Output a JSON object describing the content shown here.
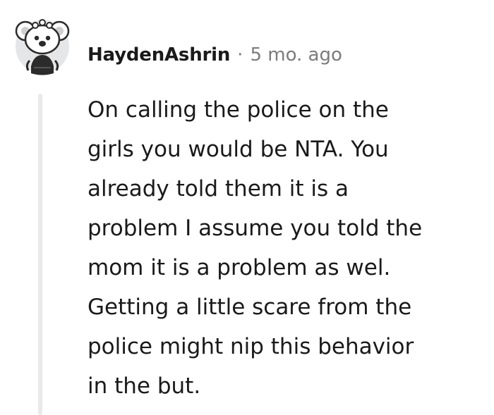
{
  "comment": {
    "author": "HaydenAshrin",
    "separator": "·",
    "time_ago": "5 mo. ago",
    "avatar_icon": "snoo-koala-avatar-icon",
    "body_lines": [
      "On calling the police on the",
      "girls you would be NTA. You",
      "already told them it is a",
      "problem I assume you told the",
      "mom it is a problem as wel.",
      "Getting a little scare from the",
      "police might nip this behavior",
      "in the but."
    ]
  },
  "colors": {
    "text": "#1a1a1b",
    "meta": "#7c7c7c",
    "thread_line": "#e9e9e9"
  }
}
